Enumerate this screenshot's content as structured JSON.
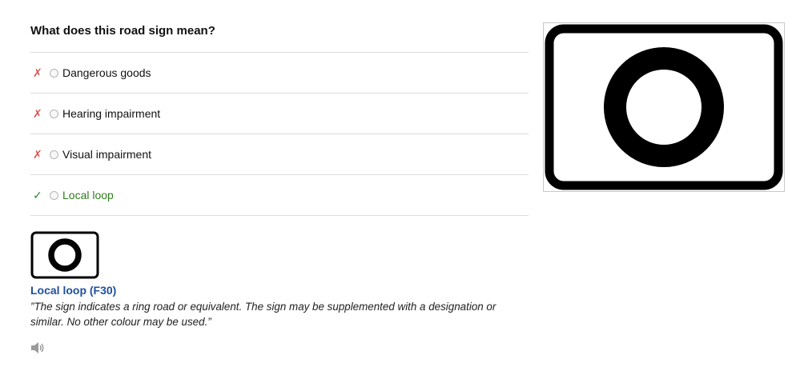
{
  "question": {
    "title": "What does this road sign mean?"
  },
  "answers": [
    {
      "label": "Dangerous goods",
      "status": "wrong",
      "mark": "✗"
    },
    {
      "label": "Hearing impairment",
      "status": "wrong",
      "mark": "✗"
    },
    {
      "label": "Visual impairment",
      "status": "wrong",
      "mark": "✗"
    },
    {
      "label": "Local loop",
      "status": "correct",
      "mark": "✓"
    }
  ],
  "explanation": {
    "title": "Local loop (F30)",
    "text": "”The sign indicates a ring road or equivalent. The sign may be supplemented with a designation or similar. No other colour may be used.”"
  },
  "icons": {
    "wrong": "cross-mark-icon",
    "correct": "check-mark-icon",
    "audio": "speaker-icon",
    "sign": "local-loop-sign-icon"
  },
  "colors": {
    "wrong_mark": "#d9534f",
    "correct_mark": "#2e8b2e",
    "correct_text": "#2e7d1e",
    "explanation_title": "#1f4f9c"
  }
}
